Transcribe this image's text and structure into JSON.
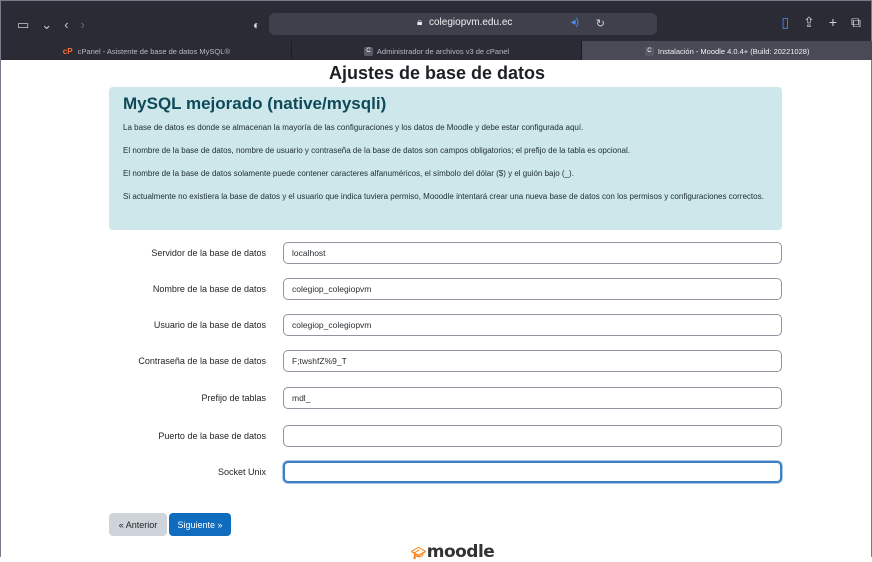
{
  "browser": {
    "url": "colegiopvm.edu.ec",
    "tabs": [
      {
        "label": "cPanel - Asistente de base de datos MySQL®",
        "icon": "cpanel-icon",
        "active": false
      },
      {
        "label": "Administrador de archivos v3 de cPanel",
        "icon": "c-icon",
        "active": false
      },
      {
        "label": "Instalación - Moodle 4.0.4+ (Build: 20221028)",
        "icon": "c-icon",
        "active": true
      }
    ]
  },
  "page": {
    "title": "Ajustes de base de datos"
  },
  "info": {
    "heading": "MySQL mejorado (native/mysqli)",
    "paragraphs": [
      "La base de datos es donde se almacenan la mayoría de las configuraciones y los datos de Moodle y debe estar configurada aquí.",
      "El nombre de la base de datos, nombre de usuario y contraseña de la base de datos son campos obligatorios; el prefijo de la tabla es opcional.",
      "El nombre de la base de datos solamente puede contener caracteres alfanuméricos, el símbolo del dólar ($) y el guión bajo (_).",
      "Si actualmente no existiera la base de datos y el usuario que indica tuviera permiso, Mooodle intentará crear una nueva base de datos con los permisos y configuraciones correctos."
    ]
  },
  "form": {
    "fields": [
      {
        "label": "Servidor de la base de datos",
        "value": "localhost"
      },
      {
        "label": "Nombre de la base de datos",
        "value": "colegiop_colegiopvm"
      },
      {
        "label": "Usuario de la base de datos",
        "value": "colegiop_colegiopvm"
      },
      {
        "label": "Contraseña de la base de datos",
        "value": "F;twshfZ%9_T"
      },
      {
        "label": "Prefijo de tablas",
        "value": "mdl_"
      },
      {
        "label": "Puerto de la base de datos",
        "value": ""
      },
      {
        "label": "Socket Unix",
        "value": ""
      }
    ]
  },
  "buttons": {
    "prev": "« Anterior",
    "next": "Siguiente »"
  },
  "footer": {
    "logo": "moodle"
  },
  "colors": {
    "info_bg": "#cde7ea",
    "heading": "#0f4a5a",
    "primary": "#0f6cbf",
    "focus": "#3e7fc4"
  }
}
